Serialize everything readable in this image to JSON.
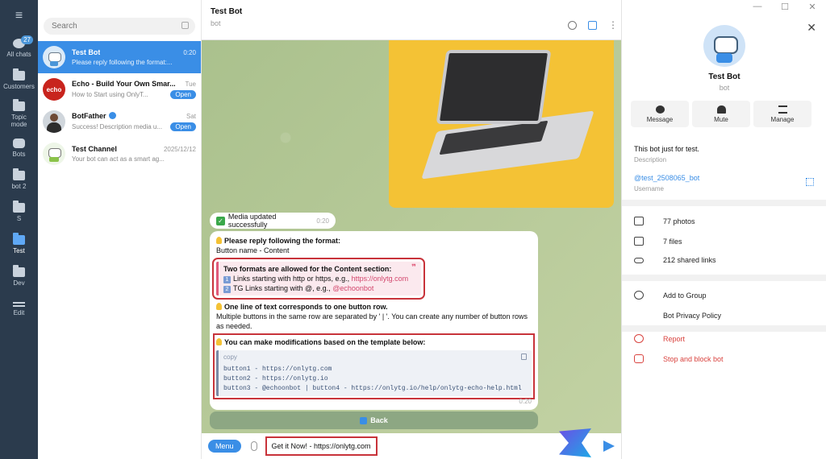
{
  "window": {
    "minimize": "—",
    "maximize": "☐",
    "close": "✕"
  },
  "rail": {
    "items": [
      {
        "label": "All chats",
        "badge": "27",
        "active": false
      },
      {
        "label": "Customers"
      },
      {
        "label": "Topic mode"
      },
      {
        "label": "Bots"
      },
      {
        "label": "bot 2"
      },
      {
        "label": "S"
      },
      {
        "label": "Test"
      },
      {
        "label": "Dev"
      },
      {
        "label": "Edit"
      }
    ]
  },
  "search": {
    "placeholder": "Search"
  },
  "chats": [
    {
      "name": "Test Bot",
      "time": "0:20",
      "snippet": "Please reply following the format:..."
    },
    {
      "name": "Echo - Build Your Own Smar...",
      "time": "Tue",
      "snippet": "How to Start using OnlyT...",
      "action": "Open",
      "avatar_text": "echo"
    },
    {
      "name": "BotFather",
      "time": "Sat",
      "snippet": "Success! Description media u...",
      "action": "Open"
    },
    {
      "name": "Test Channel",
      "time": "2025/12/12",
      "snippet": "Your bot can act as a smart ag..."
    }
  ],
  "chat": {
    "title": "Test Bot",
    "subtitle": "bot",
    "media_status": "Media updated successfully",
    "media_time": "0:20",
    "msg": {
      "format_title": "Please reply following the format:",
      "format_line": "Button name - Content",
      "quote_title": "Two formats are allowed for the Content section:",
      "quote_line1_pre": "Links starting with http or https, e.g.,",
      "quote_line1_link": "https://onlytg.com",
      "quote_line2_pre": "TG Links starting with @, e.g.,",
      "quote_line2_link": "@echoonbot",
      "row_title": "One line of text corresponds to one button row.",
      "row_desc": "Multiple buttons in the same row are separated by ' | '. You can create any number of button rows as needed.",
      "template_title": "You can make modifications based on the template below:",
      "code_label": "copy",
      "code_lines": [
        "button1 - https://onlytg.com",
        "button2 - https://onlytg.io",
        "button3 - @echoonbot | button4 - https://onlytg.io/help/onlytg-echo-help.html"
      ],
      "time": "0:20"
    },
    "back_label": "Back",
    "menu_label": "Menu",
    "input_value": "Get it Now! - https://onlytg.com"
  },
  "info": {
    "name": "Test Bot",
    "sub": "bot",
    "actions": [
      "Message",
      "Mute",
      "Manage"
    ],
    "about": "This bot just for test.",
    "about_label": "Description",
    "username": "@test_2508065_bot",
    "username_label": "Username",
    "media": [
      "77 photos",
      "7 files",
      "212 shared links"
    ],
    "more": [
      "Add to Group",
      "Bot Privacy Policy"
    ],
    "danger": [
      "Report",
      "Stop and block bot"
    ]
  },
  "colors": {
    "accent": "#3a8ee6",
    "highlight": "#c8333a",
    "rail": "#2b3b4d"
  }
}
